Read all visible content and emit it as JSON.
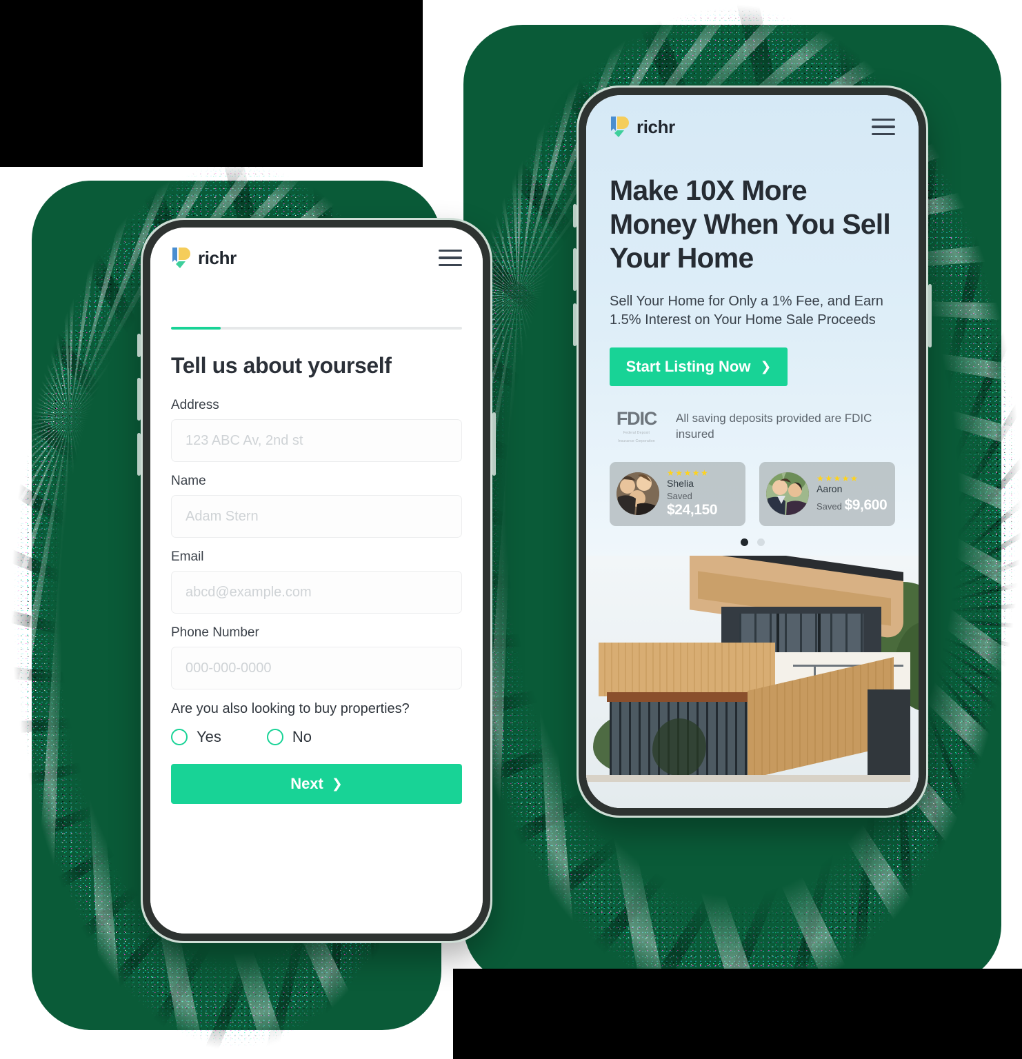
{
  "page": {
    "background_color": "#0a5b38",
    "accent_color": "#18d396",
    "plate_color": "#000000"
  },
  "left_phone": {
    "name": "onboarding-form-phone",
    "header": {
      "brand": "richr",
      "menu_icon": "hamburger-menu-icon",
      "logo_icon": "richr-logo-icon"
    },
    "progress": {
      "percent": 17,
      "label": "17%"
    },
    "form": {
      "title": "Tell us about yourself",
      "fields": [
        {
          "label": "Address",
          "placeholder": "123 ABC Av, 2nd st",
          "value": ""
        },
        {
          "label": "Name",
          "placeholder": "Adam Stern",
          "value": ""
        },
        {
          "label": "Email",
          "placeholder": "abcd@example.com",
          "value": ""
        },
        {
          "label": "Phone Number",
          "placeholder": "000-000-0000",
          "value": ""
        }
      ],
      "question": "Are you also looking to buy properties?",
      "options": [
        {
          "label": "Yes",
          "selected": false
        },
        {
          "label": "No",
          "selected": false
        }
      ],
      "submit": {
        "label": "Next",
        "chevron": "chevron-right-icon"
      }
    }
  },
  "right_phone": {
    "name": "marketing-landing-phone",
    "header": {
      "brand": "richr",
      "menu_icon": "hamburger-menu-icon",
      "logo_icon": "richr-logo-icon"
    },
    "hero": {
      "headline": "Make 10X More Money When You Sell Your Home",
      "subhead": "Sell Your Home for Only a 1% Fee, and Earn 1.5% Interest on Your Home Sale Proceeds",
      "cta": {
        "label": "Start Listing Now",
        "chevron": "chevron-right-icon"
      }
    },
    "fdic": {
      "mark": "FDIC",
      "mark_fine_line1": "Federal Deposit",
      "mark_fine_line2": "Insurance Corporation",
      "text": "All saving deposits provided are FDIC insured"
    },
    "testimonials": [
      {
        "name": "Shelia",
        "stars": "★★★★★",
        "saved_label": "Saved",
        "amount": "$24,150",
        "avatar": "avatar-photo-shelia"
      },
      {
        "name": "Aaron",
        "stars": "★★★★★",
        "saved_label": "Saved",
        "amount": "$9,600",
        "avatar": "avatar-photo-aaron"
      }
    ],
    "carousel": {
      "total": 2,
      "active_index": 0
    },
    "photo": {
      "alt": "modern-house-photo"
    }
  }
}
